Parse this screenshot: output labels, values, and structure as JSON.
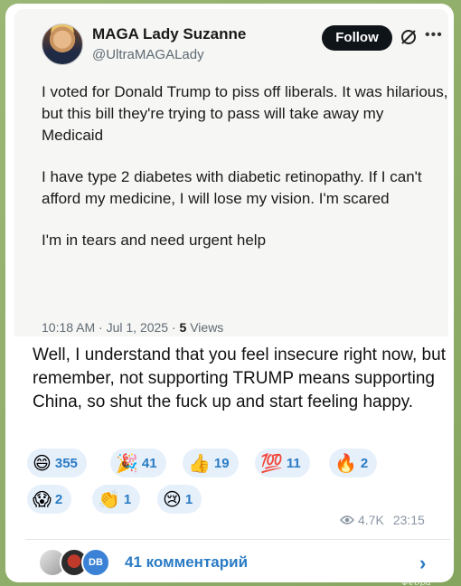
{
  "tweet": {
    "display_name": "MAGA Lady Suzanne",
    "handle": "@UltraMAGALady",
    "follow_label": "Follow",
    "paragraphs": [
      "I voted for Donald Trump to piss off liberals. It was hilarious, but this bill they're trying to pass will take away my Medicaid",
      "I have type 2 diabetes with diabetic retinopathy. If I can't afford my medicine, I will lose my vision. I'm scared",
      "I'm in tears and need urgent help"
    ],
    "timestamp": "10:18 AM · Jul 1, 2025 ·",
    "views_count": "5",
    "views_label": "Views"
  },
  "message": {
    "text": "Well, I understand that you feel insecure right now, but remember, not supporting TRUMP means supporting China, so shut the fuck up and start feeling happy."
  },
  "reactions": [
    {
      "emoji": "😄",
      "count": "355",
      "icon": "grinning-sweat-icon"
    },
    {
      "emoji": "🎉",
      "count": "41",
      "icon": "party-popper-icon"
    },
    {
      "emoji": "👍",
      "count": "19",
      "icon": "thumbs-up-icon"
    },
    {
      "emoji": "💯",
      "count": "11",
      "icon": "hundred-points-icon"
    },
    {
      "emoji": "🔥",
      "count": "2",
      "icon": "fire-icon"
    },
    {
      "emoji": "😱",
      "count": "2",
      "icon": "screaming-face-icon"
    },
    {
      "emoji": "👏",
      "count": "1",
      "icon": "clapping-hands-icon"
    },
    {
      "emoji": "😢",
      "count": "1",
      "icon": "crying-face-icon"
    }
  ],
  "footer": {
    "views": "4.7K",
    "time": "23:15"
  },
  "comments": {
    "label": "41 комментарий",
    "avatar_initials": "DB"
  },
  "watermark": "Харків Федра",
  "colors": {
    "accent": "#2a7bc4",
    "reaction_bg": "#e6f0fb",
    "chat_bg": "#8fae6b"
  }
}
